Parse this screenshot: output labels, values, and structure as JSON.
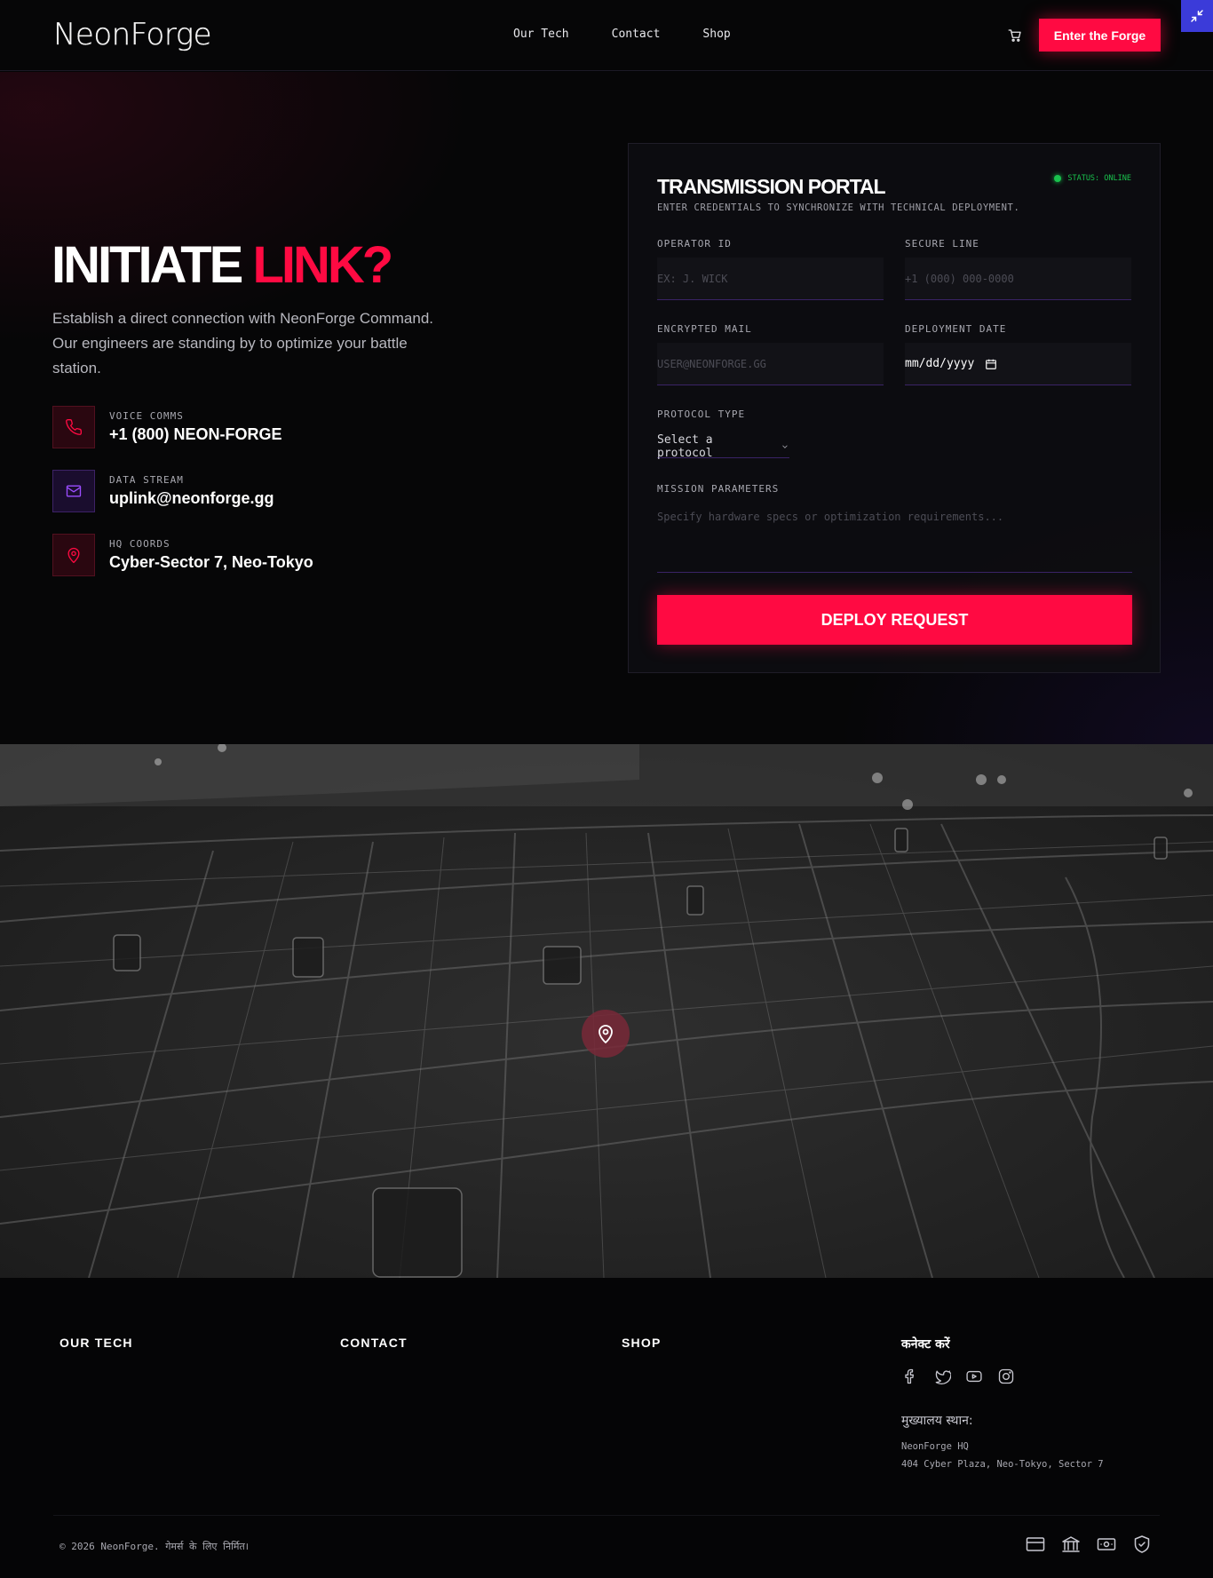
{
  "header": {
    "logo": "NeonForge",
    "nav": [
      "Our Tech",
      "Contact",
      "Shop"
    ],
    "cta_label": "Enter the Forge",
    "cart_icon": "cart-icon"
  },
  "corner_widget": {
    "icon": "minimize-arrows-icon"
  },
  "hero": {
    "title_main": "INITIATE",
    "title_accent": "LINK?",
    "description": "Establish a direct connection with NeonForge Command. Our engineers are standing by to optimize your battle station.",
    "contacts": [
      {
        "icon": "phone-icon",
        "label": "VOICE COMMS",
        "value": "+1 (800) NEON-FORGE"
      },
      {
        "icon": "mail-icon",
        "label": "DATA STREAM",
        "value": "uplink@neonforge.gg"
      },
      {
        "icon": "map-pin-icon",
        "label": "HQ COORDS",
        "value": "Cyber-Sector 7, Neo-Tokyo"
      }
    ]
  },
  "form": {
    "title": "TRANSMISSION PORTAL",
    "subtitle": "ENTER CREDENTIALS TO SYNCHRONIZE WITH TECHNICAL DEPLOYMENT.",
    "status": "STATUS: ONLINE",
    "fields": {
      "operator_id": {
        "label": "OPERATOR ID",
        "placeholder": "EX: J. WICK"
      },
      "secure_line": {
        "label": "SECURE LINE",
        "placeholder": "+1 (000) 000-0000"
      },
      "encrypted_mail": {
        "label": "ENCRYPTED MAIL",
        "placeholder": "USER@NEONFORGE.GG"
      },
      "deployment_date": {
        "label": "DEPLOYMENT DATE",
        "value": "mm/dd/yyyy"
      },
      "protocol_type": {
        "label": "PROTOCOL TYPE",
        "value": "Select a protocol"
      },
      "mission_parameters": {
        "label": "MISSION PARAMETERS",
        "placeholder": "Specify hardware specs or optimization requirements..."
      }
    },
    "submit_label": "DEPLOY REQUEST"
  },
  "map": {
    "pin_icon": "map-pin-icon"
  },
  "footer": {
    "columns": [
      "OUR TECH",
      "CONTACT",
      "SHOP"
    ],
    "connect_title": "कनेक्ट करें",
    "socials": [
      "facebook-icon",
      "twitter-icon",
      "youtube-icon",
      "instagram-icon"
    ],
    "hq_title": "मुख्यालय स्थान:",
    "hq_lines": [
      "NeonForge HQ",
      "404 Cyber Plaza, Neo-Tokyo, Sector 7"
    ],
    "copyright": "© 2026 NeonForge. गेमर्स के लिए निर्मित।",
    "payment_icons": [
      "credit-card-icon",
      "bank-icon",
      "cash-icon",
      "shield-check-icon"
    ]
  },
  "colors": {
    "accent": "#ff0a42",
    "background": "#060607",
    "status_green": "#19c24d",
    "corner_widget": "#3b3bd9",
    "field_underline": "#3a2366"
  }
}
